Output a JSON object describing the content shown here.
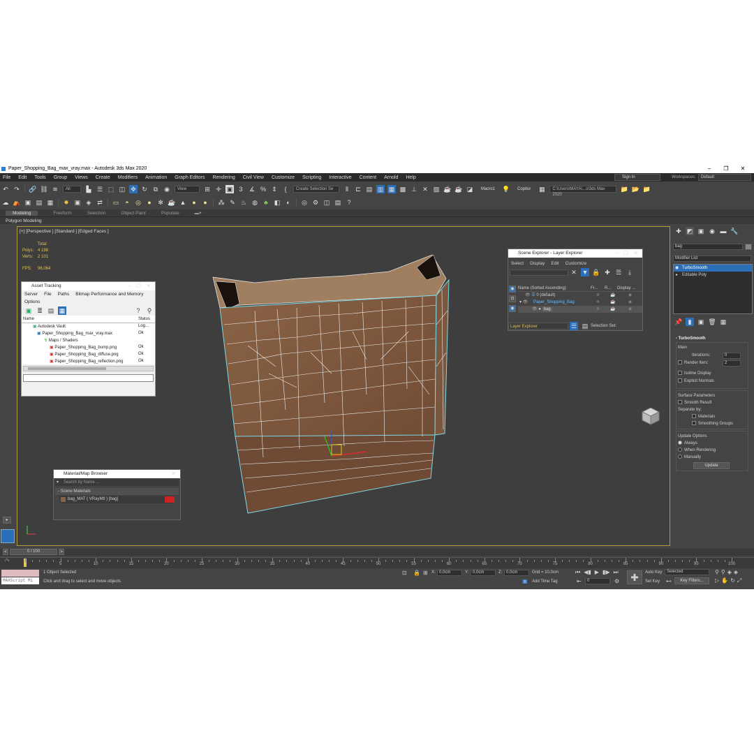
{
  "window": {
    "title": "Paper_Shopping_Bag_max_vray.max - Autodesk 3ds Max 2020",
    "minimize": "–",
    "maximize": "❐",
    "close": "✕"
  },
  "menu": [
    "File",
    "Edit",
    "Tools",
    "Group",
    "Views",
    "Create",
    "Modifiers",
    "Animation",
    "Graph Editors",
    "Rendering",
    "Civil View",
    "Customize",
    "Scripting",
    "Interactive",
    "Content",
    "Arnold",
    "Help"
  ],
  "signin": "Sign In",
  "workspaces": {
    "label": "Workspaces:",
    "value": "Default"
  },
  "toolbar": {
    "filter": "All",
    "view": "View",
    "selection_set": "Create Selection Se",
    "macro": "Macro1",
    "copitor": "Copitor",
    "project_path": "C:\\Users\\MAYA\\...s\\3ds Max 2020"
  },
  "ribbon": {
    "tabs": [
      "Modeling",
      "Freeform",
      "Selection",
      "Object Paint",
      "Populate"
    ],
    "active": "Modeling",
    "sub": "Polygon Modeling"
  },
  "viewport": {
    "label": "[+] [Perspective ] [Standard ] [Edged Faces ]",
    "stats_header": "Total",
    "polys_label": "Polys:",
    "polys": "4 198",
    "verts_label": "Verts:",
    "verts": "2 101",
    "fps_label": "FPS:",
    "fps": "96,064"
  },
  "asset_tracking": {
    "title": "Asset Tracking",
    "menu": [
      "Server",
      "File",
      "Paths",
      "Bitmap Performance and Memory"
    ],
    "options": "Options",
    "col_name": "Name",
    "col_status": "Status",
    "rows": [
      {
        "name": "Autodesk Vault",
        "status": "Log..."
      },
      {
        "name": "Paper_Shopping_Bag_max_vray.max",
        "status": "Ok"
      },
      {
        "name": "Maps / Shaders",
        "status": ""
      },
      {
        "name": "Paper_Shopping_Bag_bump.png",
        "status": "Ok"
      },
      {
        "name": "Paper_Shopping_Bag_diffuse.png",
        "status": "Ok"
      },
      {
        "name": "Paper_Shopping_Bag_reflection.png",
        "status": "Ok"
      }
    ]
  },
  "material_browser": {
    "title": "Material/Map Browser",
    "search_placeholder": "Search by Name ...",
    "section": "- Scene Materials",
    "item": "bag_MAT ( VRayMtl ) [bag]"
  },
  "scene_explorer": {
    "title": "Scene Explorer - Layer Explorer",
    "menu": [
      "Select",
      "Display",
      "Edit",
      "Customize"
    ],
    "col_name": "Name (Sorted Ascending)",
    "col_fr": "Fr...",
    "col_r": "R...",
    "col_display": "Display ...",
    "rows": [
      {
        "name": "0 (default)"
      },
      {
        "name": "Paper_Shopping_Bag"
      },
      {
        "name": "bag"
      }
    ],
    "footer_layer": "Layer Explorer",
    "footer_selset": "Selection Set:"
  },
  "command_panel": {
    "object_name": "bag",
    "modifier_list": "Modifier List",
    "stack": [
      "TurboSmooth",
      "Editable Poly"
    ],
    "rollout": "TurboSmooth",
    "main": "Main",
    "iterations_label": "Iterations:",
    "iterations": "0",
    "render_iters_label": "Render Iters:",
    "render_iters": "2",
    "isoline": "Isoline Display",
    "explicit": "Explicit Normals",
    "surface_params": "Surface Parameters",
    "smooth_result": "Smooth Result",
    "separate_by": "Separate by:",
    "materials": "Materials",
    "smoothing_groups": "Smoothing Groups",
    "update_options": "Update Options",
    "always": "Always",
    "when_rendering": "When Rendering",
    "manually": "Manually",
    "update_btn": "Update"
  },
  "timeline": {
    "frame": "0 / 100",
    "ticks": [
      "5",
      "10",
      "15",
      "20",
      "25",
      "30",
      "35",
      "40",
      "45",
      "50",
      "55",
      "60",
      "65",
      "70",
      "75",
      "80",
      "85",
      "90",
      "95",
      "100"
    ]
  },
  "status": {
    "maxscript": "MAXScript Mi",
    "selected": "1 Object Selected",
    "prompt": "Click and drag to select and move objects",
    "x_label": "X:",
    "x": "0,0cm",
    "y_label": "Y:",
    "y": "0,0cm",
    "z_label": "Z:",
    "z": "0,0cm",
    "grid": "Grid = 10,0cm",
    "add_time_tag": "Add Time Tag",
    "auto_key": "Auto Key",
    "selected_dd": "Selected",
    "set_key": "Set Key",
    "key_filters": "Key Filters...",
    "frame_field": "0"
  }
}
